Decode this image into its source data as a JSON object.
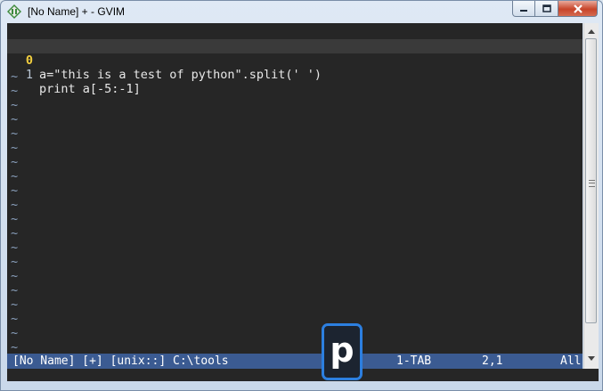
{
  "window": {
    "title": "[No Name] + - GVIM"
  },
  "caption_buttons": [
    "minimize-icon",
    "maximize-icon",
    "close-icon"
  ],
  "buffer": {
    "lines": [
      {
        "number": "1",
        "text": "",
        "current": false
      },
      {
        "number": "0",
        "text": "a=\"this is a test of python\".split(' ')",
        "current": true
      },
      {
        "number": "1",
        "text": "print a[-5:-1]",
        "current": false
      }
    ],
    "tilde": "~"
  },
  "statusline": {
    "file": "[No Name] [+] [unix::] C:\\tools",
    "tab": "1-TAB",
    "position": "2,1",
    "scroll": "All"
  },
  "overlay": {
    "badge_letter": "p"
  },
  "colors": {
    "editor_bg": "#262626",
    "statusline_bg": "#3b5b92",
    "current_line_number": "#f4d03f",
    "badge_border": "#2c7fe0"
  }
}
